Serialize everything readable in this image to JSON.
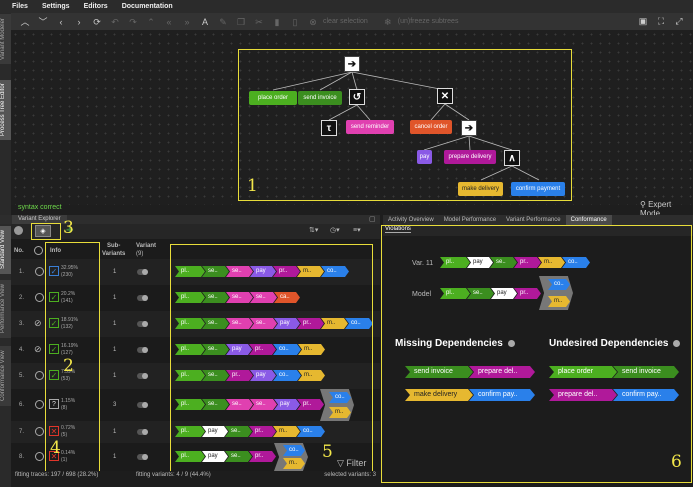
{
  "menu": [
    "Files",
    "Settings",
    "Editors",
    "Documentation"
  ],
  "toolbar": {
    "clear_selection": "clear selection",
    "freeze_subtrees": "(un)freeze subtrees"
  },
  "side_tabs": {
    "variant_modeler": "Variant Modeler",
    "process_tree_editor": "Process Tree Editor",
    "standard_view": "Standard View",
    "performance_view": "Performance View",
    "conformance_view": "Conformance View"
  },
  "tree": {
    "nodes": {
      "place_order": "place order",
      "send_invoice": "send invoice",
      "tau": "τ",
      "send_reminder": "send reminder",
      "cancel_order": "cancel order",
      "pay": "pay",
      "prepare_delivery": "prepare delivery",
      "make_delivery": "make delivery",
      "confirm_payment": "confirm payment"
    },
    "operators": {
      "sequence": "➔",
      "loop": "↺",
      "choice": "✕",
      "parallel": "∧"
    }
  },
  "syntax_status": "syntax correct",
  "expert_mode": "Expert Mode",
  "variant_explorer": {
    "title": "Variant Explorer",
    "columns": {
      "no": "No.",
      "info": "Info",
      "sub": "Sub-",
      "sub2": "Variants",
      "variant": "Variant",
      "variant_count": "(9)"
    },
    "rows": [
      {
        "no": "1.",
        "pct": "32.95%",
        "count": "(230)",
        "sub": "1"
      },
      {
        "no": "2.",
        "pct": "20.2%",
        "count": "(141)",
        "sub": "1"
      },
      {
        "no": "3.",
        "pct": "18.91%",
        "count": "(132)",
        "sub": "1"
      },
      {
        "no": "4.",
        "pct": "16.19%",
        "count": "(127)",
        "sub": "1"
      },
      {
        "no": "5.",
        "pct": "7.59%",
        "count": "(53)",
        "sub": "1"
      },
      {
        "no": "6.",
        "pct": "1.15%",
        "count": "(8)",
        "sub": "3"
      },
      {
        "no": "7.",
        "pct": "0.72%",
        "count": "(5)",
        "sub": "1"
      },
      {
        "no": "8.",
        "pct": "0.14%",
        "count": "(1)",
        "sub": "1"
      }
    ],
    "chip_labels": {
      "pl": "pl..",
      "se": "se..",
      "pay": "pay",
      "pr": "pr..",
      "m": "m..",
      "co": "co..",
      "ca": "ca.."
    },
    "filter": "Filter"
  },
  "status_bar": {
    "fitting_traces": "fitting traces: 197 / 698 (28.2%)",
    "fitting_variants": "fitting variants: 4 / 9 (44.4%)",
    "selected_variants": "selected variants: 3"
  },
  "right_tabs": [
    "Activity Overview",
    "Model Performance",
    "Variant Performance",
    "Conformance"
  ],
  "violations": {
    "tab": "Violations",
    "var_label": "Var. 11",
    "model_label": "Model",
    "missing_title": "Missing Dependencies",
    "undesired_title": "Undesired Dependencies",
    "missing": [
      [
        "send invoice",
        "prepare del.."
      ],
      [
        "make delivery",
        "confirm pay.."
      ]
    ],
    "undesired": [
      [
        "place order",
        "send invoice"
      ],
      [
        "prepare del..",
        "confirm pay.."
      ]
    ]
  },
  "annotations": [
    "1",
    "2",
    "3",
    "4",
    "5",
    "6"
  ],
  "colors": {
    "place_order": "#4caf20",
    "send_invoice": "#3b8e1f",
    "send_reminder": "#e040b0",
    "cancel_order": "#e0552a",
    "pay": "#8a5ae6",
    "prepare_delivery": "#b0199a",
    "make_delivery": "#e6b830",
    "confirm_payment": "#2a80ea",
    "pay_chip": "#ffffff",
    "yellow_box": "#e8dd3a"
  }
}
